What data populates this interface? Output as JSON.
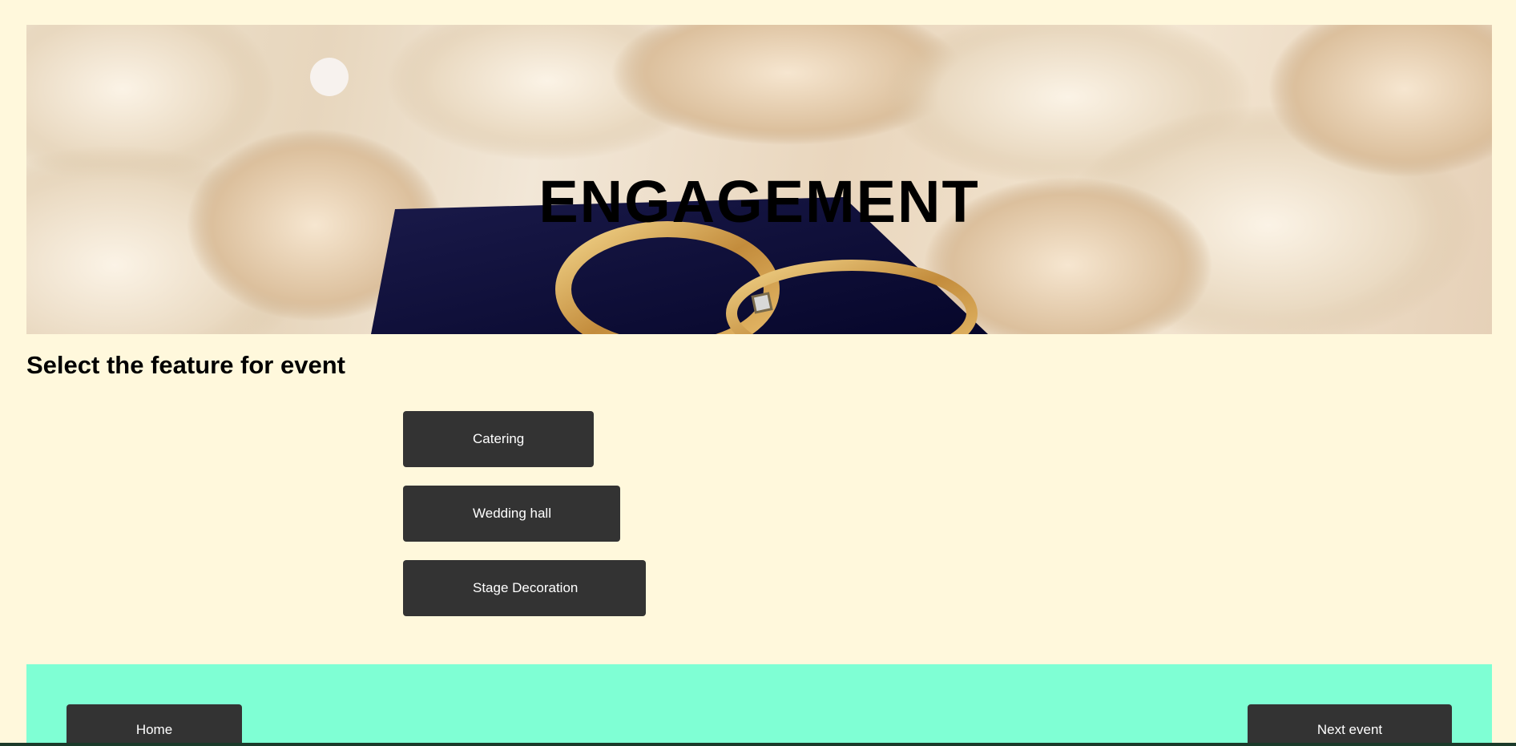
{
  "hero": {
    "title": "ENGAGEMENT"
  },
  "section": {
    "title": "Select the feature for event"
  },
  "features": [
    {
      "label": "Catering"
    },
    {
      "label": "Wedding hall"
    },
    {
      "label": "Stage Decoration"
    }
  ],
  "footer": {
    "home_label": "Home",
    "next_label": "Next event"
  },
  "colors": {
    "page_background": "#fff8dc",
    "button_background": "#333333",
    "button_text": "#ffffff",
    "footer_background": "#7fffd4"
  }
}
